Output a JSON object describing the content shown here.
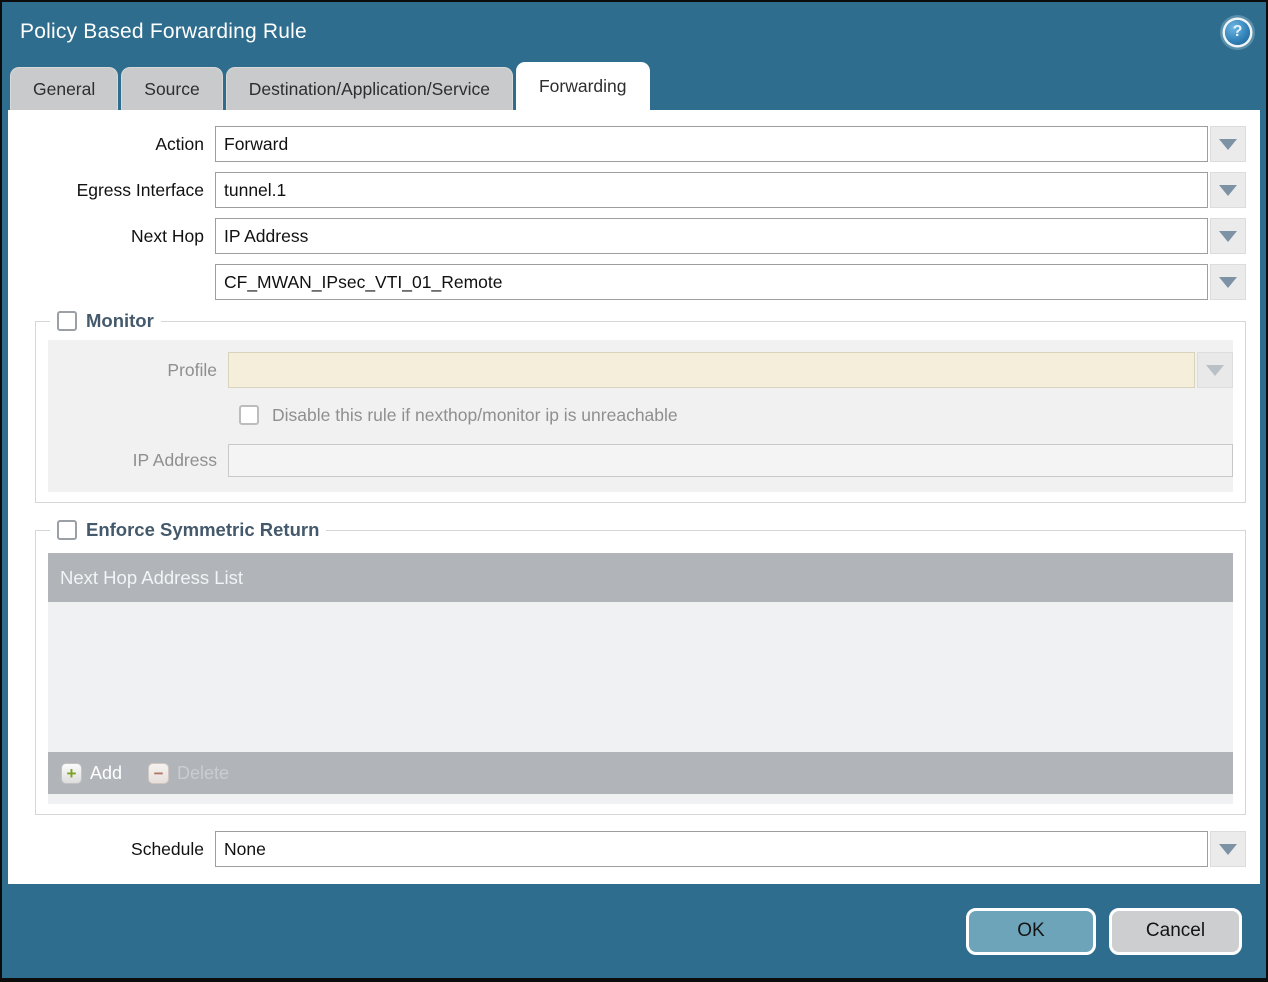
{
  "dialog": {
    "title": "Policy Based Forwarding Rule"
  },
  "icons": {
    "help": "?",
    "plus": "+",
    "minus": "−"
  },
  "tabs": [
    {
      "label": "General",
      "active": false
    },
    {
      "label": "Source",
      "active": false
    },
    {
      "label": "Destination/Application/Service",
      "active": false
    },
    {
      "label": "Forwarding",
      "active": true
    }
  ],
  "form": {
    "action": {
      "label": "Action",
      "value": "Forward"
    },
    "egress_interface": {
      "label": "Egress Interface",
      "value": "tunnel.1"
    },
    "next_hop": {
      "label": "Next Hop",
      "value": "IP Address"
    },
    "next_hop_address": {
      "value": "CF_MWAN_IPsec_VTI_01_Remote"
    },
    "schedule": {
      "label": "Schedule",
      "value": "None"
    }
  },
  "monitor": {
    "label": "Monitor",
    "checked": false,
    "profile": {
      "label": "Profile",
      "value": ""
    },
    "disable_rule": {
      "label": "Disable this rule if nexthop/monitor ip is unreachable",
      "checked": false
    },
    "ip_address": {
      "label": "IP Address",
      "value": ""
    }
  },
  "enforce_symmetric_return": {
    "label": "Enforce Symmetric Return",
    "checked": false,
    "table": {
      "header": "Next Hop Address List",
      "rows": []
    },
    "add_label": "Add",
    "delete_label": "Delete"
  },
  "buttons": {
    "ok": "OK",
    "cancel": "Cancel"
  },
  "colors": {
    "titlebar_teal": "#2e6d8d",
    "ok_button": "#6da4ba",
    "cancel_button": "#ccced0",
    "table_header_gray": "#b1b5b9",
    "disabled_field_cream": "#f5eedb",
    "group_title": "#44596b",
    "add_icon_green": "#7aa321",
    "delete_icon_red": "#b4776a"
  }
}
